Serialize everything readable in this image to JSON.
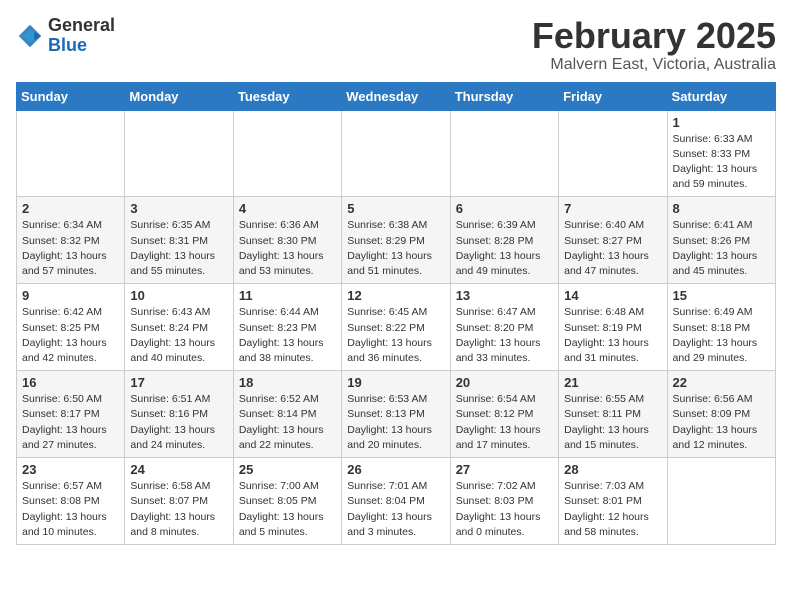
{
  "logo": {
    "general": "General",
    "blue": "Blue"
  },
  "header": {
    "month": "February 2025",
    "location": "Malvern East, Victoria, Australia"
  },
  "weekdays": [
    "Sunday",
    "Monday",
    "Tuesday",
    "Wednesday",
    "Thursday",
    "Friday",
    "Saturday"
  ],
  "weeks": [
    [
      {
        "day": "",
        "info": ""
      },
      {
        "day": "",
        "info": ""
      },
      {
        "day": "",
        "info": ""
      },
      {
        "day": "",
        "info": ""
      },
      {
        "day": "",
        "info": ""
      },
      {
        "day": "",
        "info": ""
      },
      {
        "day": "1",
        "info": "Sunrise: 6:33 AM\nSunset: 8:33 PM\nDaylight: 13 hours\nand 59 minutes."
      }
    ],
    [
      {
        "day": "2",
        "info": "Sunrise: 6:34 AM\nSunset: 8:32 PM\nDaylight: 13 hours\nand 57 minutes."
      },
      {
        "day": "3",
        "info": "Sunrise: 6:35 AM\nSunset: 8:31 PM\nDaylight: 13 hours\nand 55 minutes."
      },
      {
        "day": "4",
        "info": "Sunrise: 6:36 AM\nSunset: 8:30 PM\nDaylight: 13 hours\nand 53 minutes."
      },
      {
        "day": "5",
        "info": "Sunrise: 6:38 AM\nSunset: 8:29 PM\nDaylight: 13 hours\nand 51 minutes."
      },
      {
        "day": "6",
        "info": "Sunrise: 6:39 AM\nSunset: 8:28 PM\nDaylight: 13 hours\nand 49 minutes."
      },
      {
        "day": "7",
        "info": "Sunrise: 6:40 AM\nSunset: 8:27 PM\nDaylight: 13 hours\nand 47 minutes."
      },
      {
        "day": "8",
        "info": "Sunrise: 6:41 AM\nSunset: 8:26 PM\nDaylight: 13 hours\nand 45 minutes."
      }
    ],
    [
      {
        "day": "9",
        "info": "Sunrise: 6:42 AM\nSunset: 8:25 PM\nDaylight: 13 hours\nand 42 minutes."
      },
      {
        "day": "10",
        "info": "Sunrise: 6:43 AM\nSunset: 8:24 PM\nDaylight: 13 hours\nand 40 minutes."
      },
      {
        "day": "11",
        "info": "Sunrise: 6:44 AM\nSunset: 8:23 PM\nDaylight: 13 hours\nand 38 minutes."
      },
      {
        "day": "12",
        "info": "Sunrise: 6:45 AM\nSunset: 8:22 PM\nDaylight: 13 hours\nand 36 minutes."
      },
      {
        "day": "13",
        "info": "Sunrise: 6:47 AM\nSunset: 8:20 PM\nDaylight: 13 hours\nand 33 minutes."
      },
      {
        "day": "14",
        "info": "Sunrise: 6:48 AM\nSunset: 8:19 PM\nDaylight: 13 hours\nand 31 minutes."
      },
      {
        "day": "15",
        "info": "Sunrise: 6:49 AM\nSunset: 8:18 PM\nDaylight: 13 hours\nand 29 minutes."
      }
    ],
    [
      {
        "day": "16",
        "info": "Sunrise: 6:50 AM\nSunset: 8:17 PM\nDaylight: 13 hours\nand 27 minutes."
      },
      {
        "day": "17",
        "info": "Sunrise: 6:51 AM\nSunset: 8:16 PM\nDaylight: 13 hours\nand 24 minutes."
      },
      {
        "day": "18",
        "info": "Sunrise: 6:52 AM\nSunset: 8:14 PM\nDaylight: 13 hours\nand 22 minutes."
      },
      {
        "day": "19",
        "info": "Sunrise: 6:53 AM\nSunset: 8:13 PM\nDaylight: 13 hours\nand 20 minutes."
      },
      {
        "day": "20",
        "info": "Sunrise: 6:54 AM\nSunset: 8:12 PM\nDaylight: 13 hours\nand 17 minutes."
      },
      {
        "day": "21",
        "info": "Sunrise: 6:55 AM\nSunset: 8:11 PM\nDaylight: 13 hours\nand 15 minutes."
      },
      {
        "day": "22",
        "info": "Sunrise: 6:56 AM\nSunset: 8:09 PM\nDaylight: 13 hours\nand 12 minutes."
      }
    ],
    [
      {
        "day": "23",
        "info": "Sunrise: 6:57 AM\nSunset: 8:08 PM\nDaylight: 13 hours\nand 10 minutes."
      },
      {
        "day": "24",
        "info": "Sunrise: 6:58 AM\nSunset: 8:07 PM\nDaylight: 13 hours\nand 8 minutes."
      },
      {
        "day": "25",
        "info": "Sunrise: 7:00 AM\nSunset: 8:05 PM\nDaylight: 13 hours\nand 5 minutes."
      },
      {
        "day": "26",
        "info": "Sunrise: 7:01 AM\nSunset: 8:04 PM\nDaylight: 13 hours\nand 3 minutes."
      },
      {
        "day": "27",
        "info": "Sunrise: 7:02 AM\nSunset: 8:03 PM\nDaylight: 13 hours\nand 0 minutes."
      },
      {
        "day": "28",
        "info": "Sunrise: 7:03 AM\nSunset: 8:01 PM\nDaylight: 12 hours\nand 58 minutes."
      },
      {
        "day": "",
        "info": ""
      }
    ]
  ]
}
